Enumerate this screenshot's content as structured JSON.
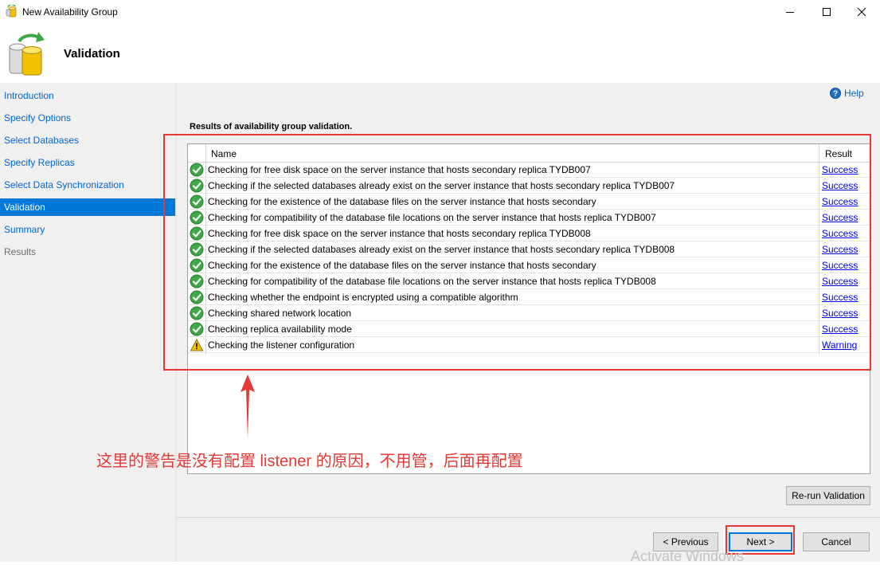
{
  "window": {
    "title": "New Availability Group"
  },
  "header": {
    "title": "Validation"
  },
  "sidebar": {
    "items": [
      {
        "label": "Introduction",
        "state": "link"
      },
      {
        "label": "Specify Options",
        "state": "link"
      },
      {
        "label": "Select Databases",
        "state": "link"
      },
      {
        "label": "Specify Replicas",
        "state": "link"
      },
      {
        "label": "Select Data Synchronization",
        "state": "link"
      },
      {
        "label": "Validation",
        "state": "active"
      },
      {
        "label": "Summary",
        "state": "link"
      },
      {
        "label": "Results",
        "state": "disabled"
      }
    ]
  },
  "help": {
    "label": "Help"
  },
  "results": {
    "title": "Results of availability group validation.",
    "columns": {
      "name": "Name",
      "result": "Result"
    },
    "rows": [
      {
        "name": "Checking for free disk space on the server instance that hosts secondary replica TYDB007",
        "result": "Success",
        "status": "success"
      },
      {
        "name": "Checking if the selected databases already exist on the server instance that hosts secondary replica TYDB007",
        "result": "Success",
        "status": "success"
      },
      {
        "name": "Checking for the existence of the database files on the server instance that hosts secondary",
        "result": "Success",
        "status": "success"
      },
      {
        "name": "Checking for compatibility of the database file locations on the server instance that hosts replica TYDB007",
        "result": "Success",
        "status": "success"
      },
      {
        "name": "Checking for free disk space on the server instance that hosts secondary replica TYDB008",
        "result": "Success",
        "status": "success"
      },
      {
        "name": "Checking if the selected databases already exist on the server instance that hosts secondary replica TYDB008",
        "result": "Success",
        "status": "success"
      },
      {
        "name": "Checking for the existence of the database files on the server instance that hosts secondary",
        "result": "Success",
        "status": "success"
      },
      {
        "name": "Checking for compatibility of the database file locations on the server instance that hosts replica TYDB008",
        "result": "Success",
        "status": "success"
      },
      {
        "name": "Checking whether the endpoint is encrypted using a compatible algorithm",
        "result": "Success",
        "status": "success"
      },
      {
        "name": "Checking shared network location",
        "result": "Success",
        "status": "success"
      },
      {
        "name": "Checking replica availability mode",
        "result": "Success",
        "status": "success"
      },
      {
        "name": "Checking the listener configuration",
        "result": "Warning",
        "status": "warning"
      }
    ]
  },
  "annotation": {
    "text": "这里的警告是没有配置 listener 的原因，不用管，后面再配置"
  },
  "buttons": {
    "rerun": "Re-run Validation",
    "previous": "< Previous",
    "next": "Next >",
    "cancel": "Cancel"
  },
  "watermark": "Activate Windows",
  "colors": {
    "accent": "#0078d7",
    "link": "#0066cc",
    "annotation": "#e53935",
    "success": "#3fa845",
    "warning": "#f5c400"
  }
}
